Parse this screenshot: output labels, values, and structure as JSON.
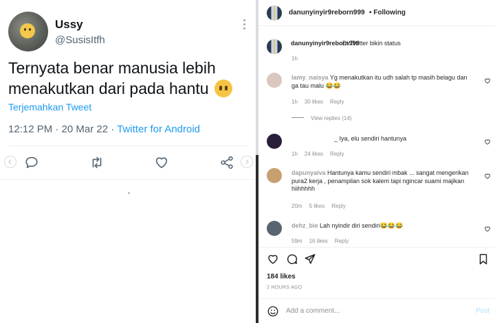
{
  "tweet": {
    "display_name": "Ussy",
    "handle": "@SusisItfh",
    "text": "Ternyata benar manusia lebih menakutkan dari pada hantu",
    "translate_label": "Terjemahkan Tweet",
    "time_date": "12:12 PM · 20 Mar 22 · ",
    "source": "Twitter for Android",
    "icons": [
      "reply-icon",
      "retweet-icon",
      "like-icon",
      "share-icon"
    ]
  },
  "instagram": {
    "header": {
      "username": "danunyinyir9reborn999",
      "following_label": "• Following"
    },
    "caption": {
      "username": "danunyinyir9reborn999",
      "text": "Di Twitter bikin status",
      "time": "1h"
    },
    "comments": [
      {
        "username": "lamy_naisya",
        "text": "Yg menakutkan itu udh salah tp masih belagu dan ga tau malu 😂😂",
        "time": "1h",
        "likes": "30 likes",
        "reply": "Reply",
        "avatar_color": "#d9c7c0",
        "view_replies": "View replies (14)"
      },
      {
        "username": "",
        "text": "_ Iya, elu sendiri hantunya",
        "time": "1h",
        "likes": "24 likes",
        "reply": "Reply",
        "avatar_color": "#2a1f3a"
      },
      {
        "username": "dapunyaiva",
        "text": "Hantunya kamu sendiri mbak ... sangat mengerikan pura2 kerja , penampilan sok kalem tapi ngincar suami majikan hiihhhhh",
        "time": "20m",
        "likes": "5 likes",
        "reply": "Reply",
        "avatar_color": "#c8a070"
      },
      {
        "username": "dehz_bie",
        "text": "Lah nyindir diri sendiri😂😂😂",
        "time": "59m",
        "likes": "16 likes",
        "reply": "Reply",
        "avatar_color": "#5a6470"
      }
    ],
    "likes": "184 likes",
    "posted_ago": "2 HOURS AGO",
    "add_comment_placeholder": "Add a comment...",
    "post_label": "Post",
    "colors": {
      "link_blue": "#1d9bf0",
      "muted": "#8e8e8e",
      "post_disabled": "#b2dffc"
    }
  }
}
